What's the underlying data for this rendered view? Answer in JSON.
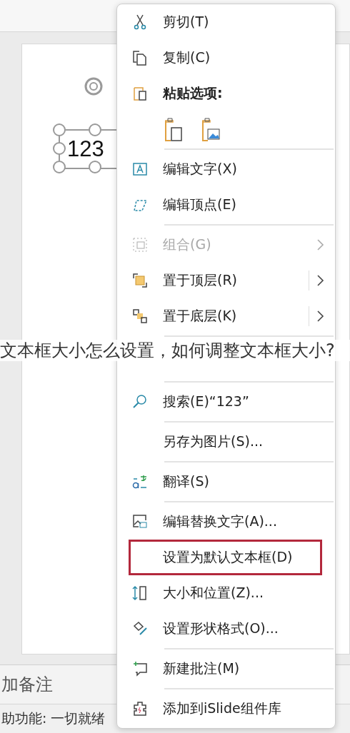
{
  "slide": {
    "textbox": "123"
  },
  "caption": "文本框大小怎么设置，如何调整文本框大小?",
  "notes": "加备注",
  "status_bar": "助功能: 一切就绪",
  "menu": [
    {
      "kind": "item",
      "label": "剪切(T)",
      "disabled": false,
      "submenu": false,
      "outlined": false,
      "separator_after": false
    },
    {
      "kind": "item",
      "label": "复制(C)",
      "disabled": false,
      "submenu": false,
      "outlined": false,
      "separator_after": false
    },
    {
      "kind": "header",
      "label": "粘贴选项:",
      "disabled": false,
      "submenu": false,
      "outlined": false,
      "separator_after": false
    },
    {
      "kind": "paste_options",
      "separator_after": true
    },
    {
      "kind": "item",
      "label": "编辑文字(X)",
      "disabled": false,
      "submenu": false,
      "outlined": false,
      "separator_after": false
    },
    {
      "kind": "item",
      "label": "编辑顶点(E)",
      "disabled": false,
      "submenu": false,
      "outlined": false,
      "separator_after": true
    },
    {
      "kind": "item",
      "label": "组合(G)",
      "disabled": true,
      "submenu": true,
      "outlined": false,
      "separator_after": false
    },
    {
      "kind": "item",
      "label": "置于顶层(R)",
      "disabled": false,
      "submenu": true,
      "outlined": false,
      "separator_after": false
    },
    {
      "kind": "item",
      "label": "置于底层(K)",
      "disabled": false,
      "submenu": true,
      "outlined": false,
      "separator_after": true
    },
    {
      "kind": "hidden",
      "separator_after": true
    },
    {
      "kind": "item",
      "label": "搜索(E)“123”",
      "disabled": false,
      "submenu": false,
      "outlined": false,
      "separator_after": true
    },
    {
      "kind": "item",
      "label": "另存为图片(S)...",
      "disabled": false,
      "submenu": false,
      "outlined": false,
      "separator_after": true
    },
    {
      "kind": "item",
      "label": "翻译(S)",
      "disabled": false,
      "submenu": false,
      "outlined": false,
      "separator_after": true
    },
    {
      "kind": "item",
      "label": "编辑替换文字(A)...",
      "disabled": false,
      "submenu": false,
      "outlined": false,
      "separator_after": false
    },
    {
      "kind": "item",
      "label": "设置为默认文本框(D)",
      "disabled": false,
      "submenu": false,
      "outlined": true,
      "separator_after": false
    },
    {
      "kind": "item",
      "label": "大小和位置(Z)...",
      "disabled": false,
      "submenu": false,
      "outlined": false,
      "separator_after": false
    },
    {
      "kind": "item",
      "label": "设置形状格式(O)...",
      "disabled": false,
      "submenu": false,
      "outlined": false,
      "separator_after": true
    },
    {
      "kind": "item",
      "label": "新建批注(M)",
      "disabled": false,
      "submenu": false,
      "outlined": false,
      "separator_after": true
    },
    {
      "kind": "item",
      "label": "添加到iSlide组件库",
      "disabled": false,
      "submenu": false,
      "outlined": false,
      "separator_after": false
    }
  ]
}
